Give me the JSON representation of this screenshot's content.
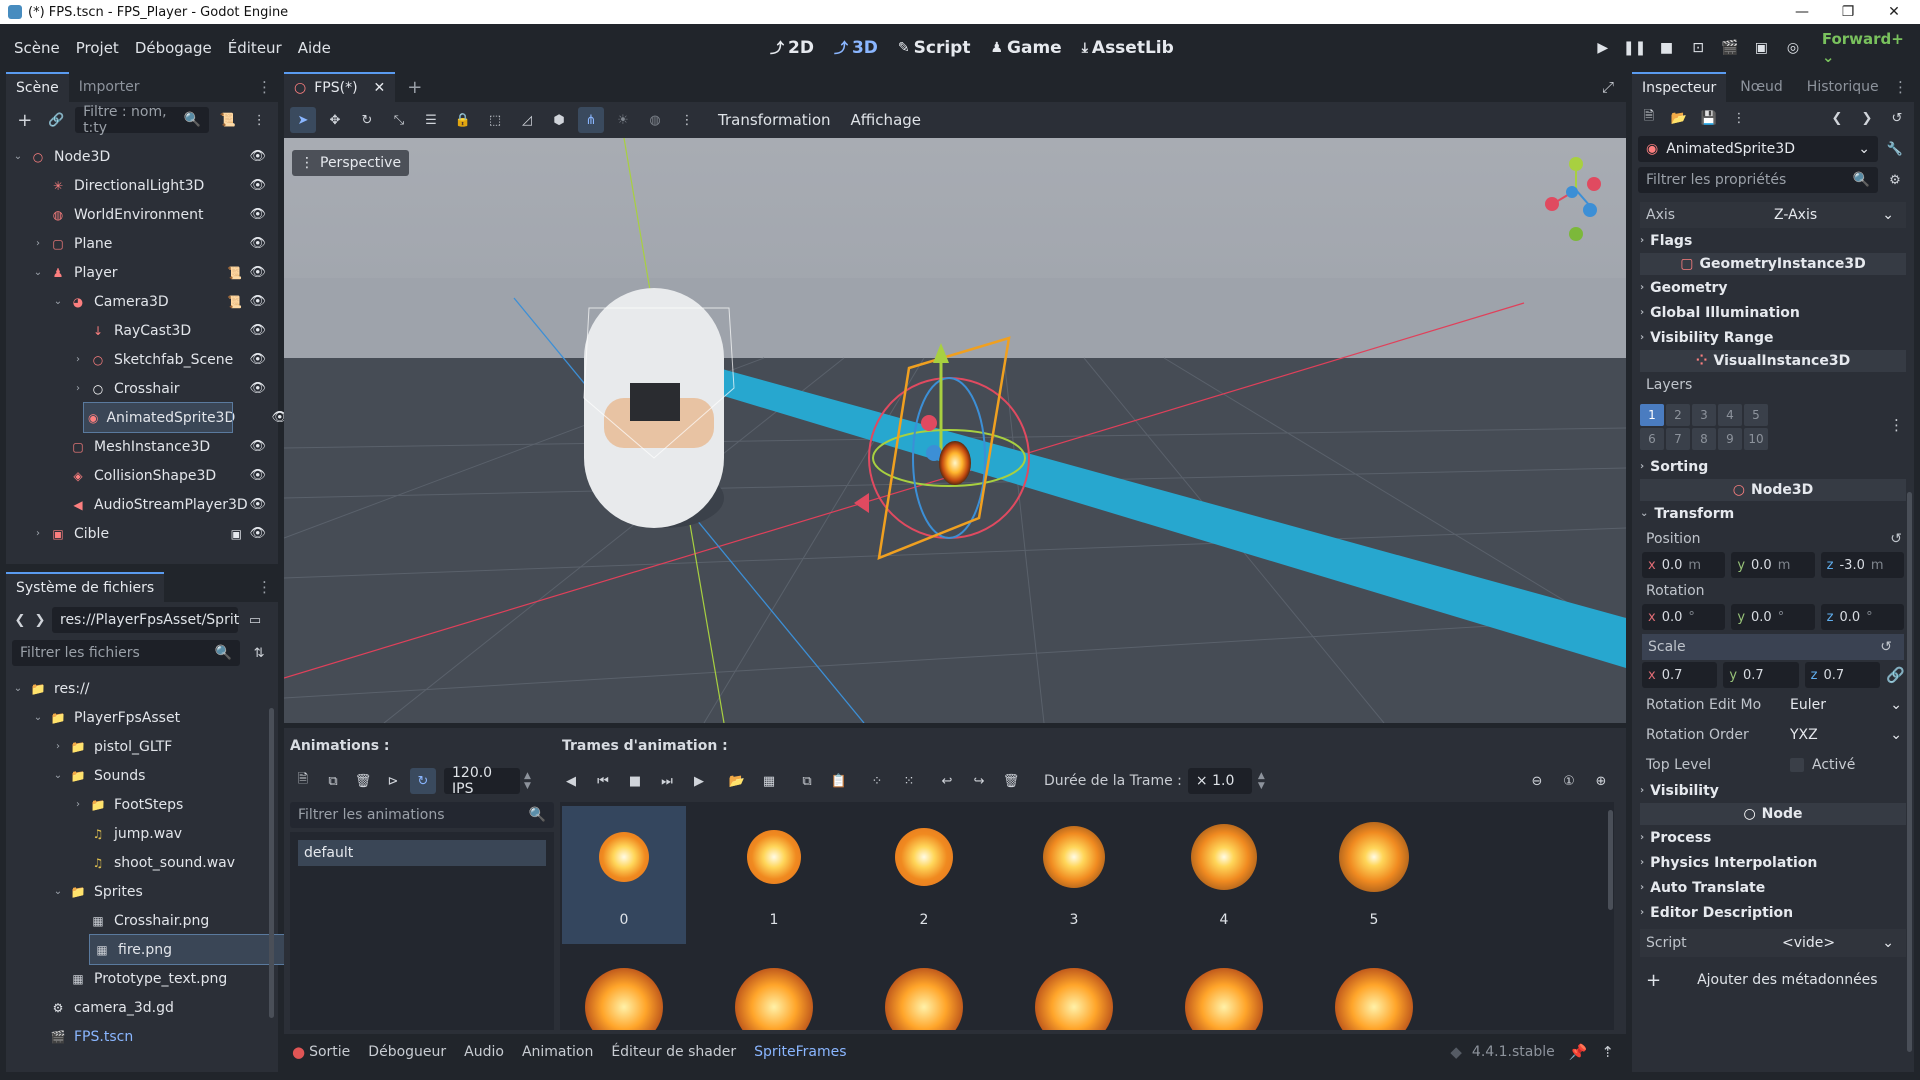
{
  "window": {
    "title": "(*) FPS.tscn - FPS_Player - Godot Engine"
  },
  "menu": [
    "Scène",
    "Projet",
    "Débogage",
    "Éditeur",
    "Aide"
  ],
  "workspaces": [
    {
      "label": "2D",
      "icon": "2d-icon"
    },
    {
      "label": "3D",
      "icon": "3d-icon"
    },
    {
      "label": "Script",
      "icon": "script-icon"
    },
    {
      "label": "Game",
      "icon": "game-icon"
    },
    {
      "label": "AssetLib",
      "icon": "assetlib-icon"
    }
  ],
  "renderer": "Forward+",
  "scene_panel": {
    "tabs": [
      "Scène",
      "Importer"
    ],
    "filter_placeholder": "Filtre : nom, t:ty",
    "nodes": [
      {
        "name": "Node3D",
        "icon": "node3d-icon",
        "color": "#fc7f7f",
        "indent": 0,
        "arrow": "down",
        "extra": ""
      },
      {
        "name": "DirectionalLight3D",
        "icon": "light-icon",
        "color": "#fc7f7f",
        "indent": 1,
        "arrow": "",
        "extra": ""
      },
      {
        "name": "WorldEnvironment",
        "icon": "world-environment-icon",
        "color": "#fc7f7f",
        "indent": 1,
        "arrow": "",
        "extra": ""
      },
      {
        "name": "Plane",
        "icon": "mesh-instance-icon",
        "color": "#fc7f7f",
        "indent": 1,
        "arrow": "right",
        "extra": ""
      },
      {
        "name": "Player",
        "icon": "character-body-icon",
        "color": "#fc7f7f",
        "indent": 1,
        "arrow": "down",
        "extra": "script"
      },
      {
        "name": "Camera3D",
        "icon": "camera-icon",
        "color": "#fc7f7f",
        "indent": 2,
        "arrow": "down",
        "extra": "script"
      },
      {
        "name": "RayCast3D",
        "icon": "raycast-icon",
        "color": "#fc7f7f",
        "indent": 3,
        "arrow": "",
        "extra": ""
      },
      {
        "name": "Sketchfab_Scene",
        "icon": "node3d-icon",
        "color": "#fc7f7f",
        "indent": 3,
        "arrow": "right",
        "extra": ""
      },
      {
        "name": "Crosshair",
        "icon": "control-icon",
        "color": "#ffffff",
        "indent": 3,
        "arrow": "right",
        "extra": ""
      },
      {
        "name": "AnimatedSprite3D",
        "icon": "animated-sprite-icon",
        "color": "#fc7f7f",
        "indent": 3,
        "arrow": "",
        "extra": "",
        "selected": true
      },
      {
        "name": "MeshInstance3D",
        "icon": "mesh-instance-icon",
        "color": "#fc7f7f",
        "indent": 2,
        "arrow": "",
        "extra": ""
      },
      {
        "name": "CollisionShape3D",
        "icon": "collision-shape-icon",
        "color": "#fc7f7f",
        "indent": 2,
        "arrow": "",
        "extra": ""
      },
      {
        "name": "AudioStreamPlayer3D",
        "icon": "audio-player-icon",
        "color": "#fc7f7f",
        "indent": 2,
        "arrow": "",
        "extra": ""
      },
      {
        "name": "Cible",
        "icon": "target-scene-icon",
        "color": "#fc7f7f",
        "indent": 1,
        "arrow": "right",
        "extra": "instance"
      }
    ]
  },
  "filesystem": {
    "title": "Système de fichiers",
    "path": "res://PlayerFpsAsset/Sprit",
    "filter_placeholder": "Filtrer les fichiers",
    "items": [
      {
        "name": "res://",
        "type": "folder",
        "indent": 0,
        "arrow": "down"
      },
      {
        "name": "PlayerFpsAsset",
        "type": "folder",
        "indent": 1,
        "arrow": "down"
      },
      {
        "name": "pistol_GLTF",
        "type": "folder",
        "indent": 2,
        "arrow": "right"
      },
      {
        "name": "Sounds",
        "type": "folder",
        "indent": 2,
        "arrow": "down"
      },
      {
        "name": "FootSteps",
        "type": "folder",
        "indent": 3,
        "arrow": "right"
      },
      {
        "name": "jump.wav",
        "type": "audio",
        "indent": 3,
        "arrow": ""
      },
      {
        "name": "shoot_sound.wav",
        "type": "audio",
        "indent": 3,
        "arrow": ""
      },
      {
        "name": "Sprites",
        "type": "folder",
        "indent": 2,
        "arrow": "down"
      },
      {
        "name": "Crosshair.png",
        "type": "image",
        "indent": 3,
        "arrow": ""
      },
      {
        "name": "fire.png",
        "type": "image",
        "indent": 3,
        "arrow": "",
        "selected": true
      },
      {
        "name": "Prototype_text.png",
        "type": "image",
        "indent": 2,
        "arrow": ""
      },
      {
        "name": "camera_3d.gd",
        "type": "gear",
        "indent": 1,
        "arrow": ""
      },
      {
        "name": "FPS.tscn",
        "type": "scene",
        "indent": 1,
        "arrow": "",
        "highlight": true
      }
    ]
  },
  "editor_tab": {
    "name": "FPS(*)"
  },
  "viewport": {
    "toolbar_menus": [
      "Transformation",
      "Affichage"
    ],
    "perspective_label": "Perspective"
  },
  "sprite_frames": {
    "animations_label": "Animations :",
    "frames_label": "Trames d'animation :",
    "fps": "120.0 IPS",
    "frame_duration_label": "Durée de la Trame :",
    "frame_duration_value": "× 1.0",
    "filter_placeholder": "Filtrer les animations",
    "animations": [
      "default"
    ],
    "frames": [
      "0",
      "1",
      "2",
      "3",
      "4",
      "5"
    ]
  },
  "bottom_bar": {
    "tabs": [
      "Sortie",
      "Débogueur",
      "Audio",
      "Animation",
      "Éditeur de shader",
      "SpriteFrames"
    ],
    "active": "SpriteFrames",
    "version": "4.4.1.stable"
  },
  "inspector": {
    "tabs": [
      "Inspecteur",
      "Nœud",
      "Historique"
    ],
    "node_name": "AnimatedSprite3D",
    "filter_placeholder": "Filtrer les propriétés",
    "axis_label": "Axis",
    "axis_value": "Z-Axis",
    "flags": "Flags",
    "cat_geometry_instance": "GeometryInstance3D",
    "geometry": "Geometry",
    "global_illumination": "Global Illumination",
    "visibility_range": "Visibility Range",
    "cat_visual_instance": "VisualInstance3D",
    "layers_label": "Layers",
    "layers": [
      "1",
      "2",
      "3",
      "4",
      "5",
      "6",
      "7",
      "8",
      "9",
      "10"
    ],
    "sorting": "Sorting",
    "cat_node3d": "Node3D",
    "transform": "Transform",
    "position_label": "Position",
    "position": {
      "x": "0.0",
      "y": "0.0",
      "z": "-3.0",
      "unit": "m"
    },
    "rotation_label": "Rotation",
    "rotation": {
      "x": "0.0",
      "y": "0.0",
      "z": "0.0",
      "unit": "°"
    },
    "scale_label": "Scale",
    "scale": {
      "x": "0.7",
      "y": "0.7",
      "z": "0.7"
    },
    "rotation_edit_mode_label": "Rotation Edit Mo",
    "rotation_edit_mode_value": "Euler",
    "rotation_order_label": "Rotation Order",
    "rotation_order_value": "YXZ",
    "top_level_label": "Top Level",
    "top_level_value": "Activé",
    "visibility": "Visibility",
    "cat_node": "Node",
    "process": "Process",
    "physics_interpolation": "Physics Interpolation",
    "auto_translate": "Auto Translate",
    "editor_description": "Editor Description",
    "script_label": "Script",
    "script_value": "<vide>",
    "add_metadata": "Ajouter des métadonnées"
  },
  "colors": {
    "accent": "#5a9bf0",
    "node3d": "#fc7f7f",
    "bg": "#21252b",
    "panel": "#2b2f37"
  }
}
